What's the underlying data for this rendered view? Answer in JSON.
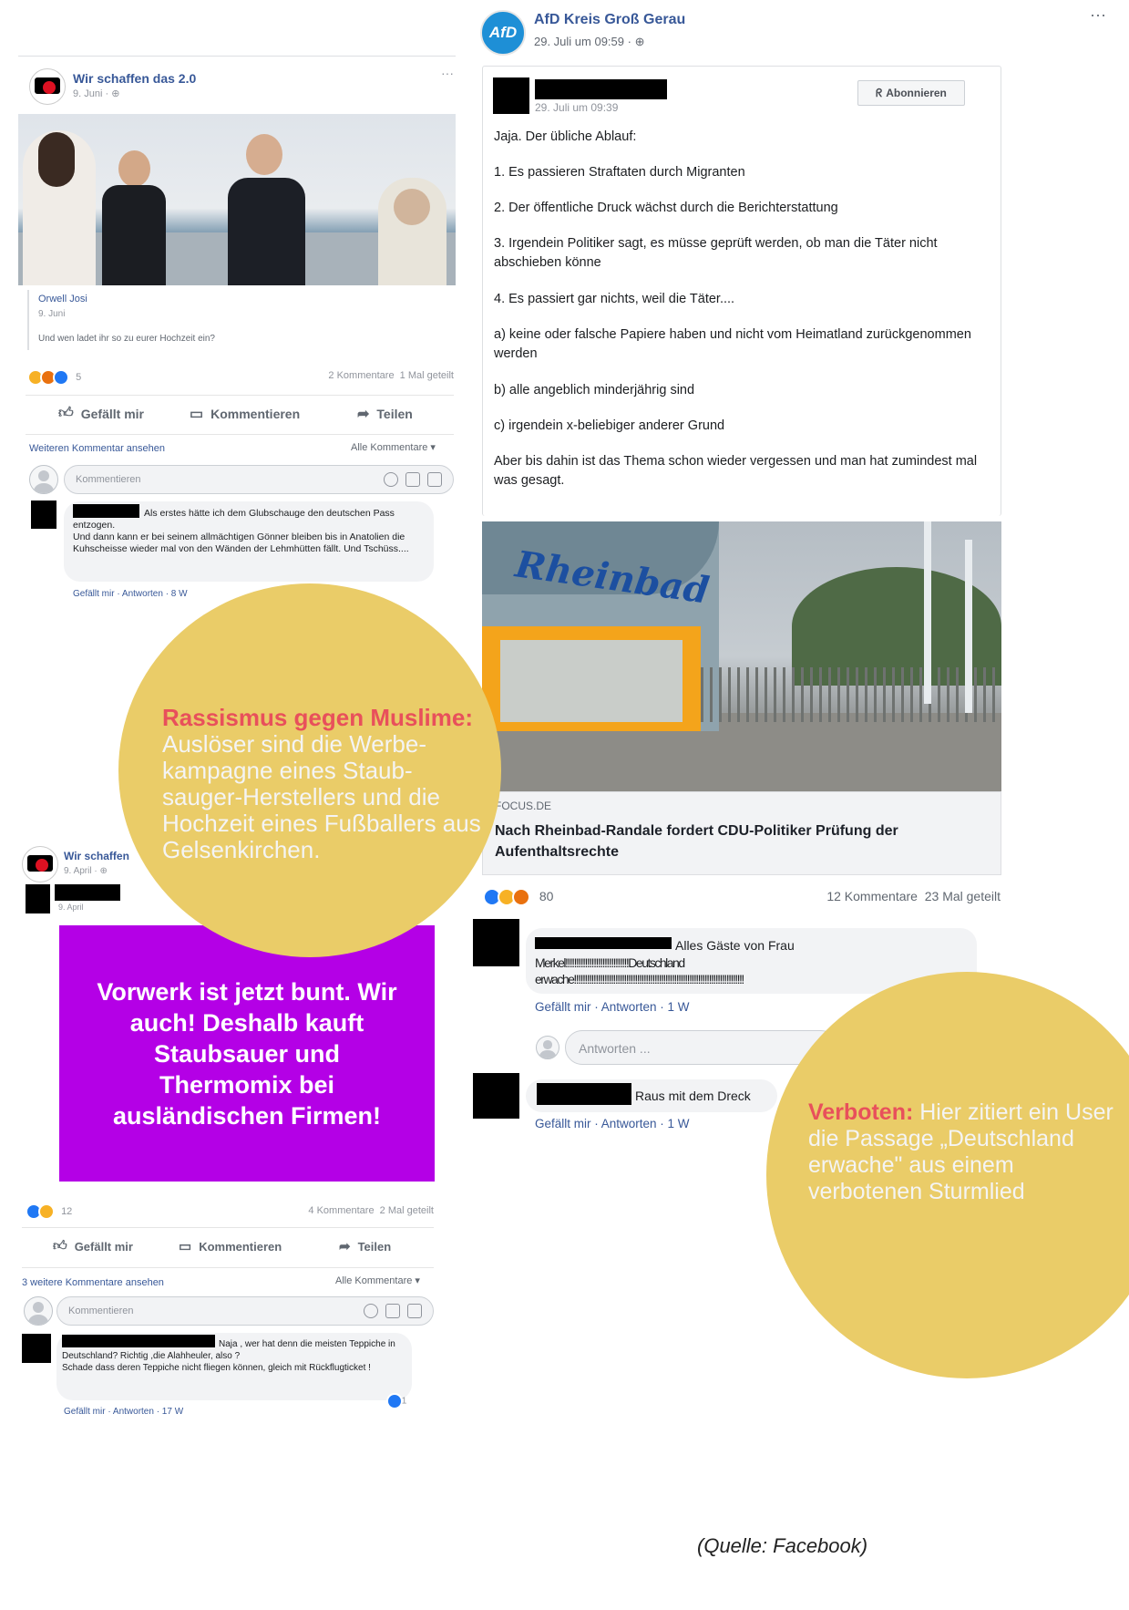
{
  "post_left": {
    "page_name": "Wir schaffen das 2.0",
    "date": "9. Juni",
    "options": "···",
    "quote": {
      "author": "Orwell Josi",
      "date": "9. Juni",
      "text": "Und wen ladet ihr so zu eurer Hochzeit ein?"
    },
    "reaction_count": "5",
    "stats": "2 Kommentare  1 Mal geteilt",
    "actions": {
      "like": "Gefällt mir",
      "comment": "Kommentieren",
      "share": "Teilen"
    },
    "more_comments": "Weiteren Kommentar ansehen",
    "filter": "Alle Kommentare ▾",
    "comment_placeholder": "Kommentieren",
    "comment": {
      "text": "Als erstes hätte ich dem Glubschauge den deutschen Pass entzogen.\nUnd dann kann er bei seinem allmächtigen Gönner bleiben bis in Anatolien die Kuhscheisse wieder mal von den Wänden der Lehmhütten fällt. Und Tschüss....",
      "actions": "Gefällt mir · Antworten · 8 W"
    }
  },
  "post_left2": {
    "page_name": "Wir schaffen",
    "date": "9. April",
    "author_date": "9. April",
    "image_text": "Vorwerk ist jetzt bunt. Wir auch! Deshalb kauft Staubsauer und Thermomix bei ausländischen Firmen!",
    "reaction_count": "12",
    "stats": "4 Kommentare  2 Mal geteilt",
    "actions": {
      "like": "Gefällt mir",
      "comment": "Kommentieren",
      "share": "Teilen"
    },
    "more_comments": "3 weitere Kommentare ansehen",
    "filter": "Alle Kommentare ▾",
    "comment_placeholder": "Kommentieren",
    "comment": {
      "text": "Naja , wer hat denn die meisten Teppiche in Deutschland? Richtig ,die Alahheuler, also ?\nSchade dass deren Teppiche nicht fliegen können, gleich mit Rückflugticket !",
      "actions": "Gefällt mir · Antworten · 17 W",
      "reaction": "1"
    }
  },
  "post_right": {
    "page_logo": "AfD",
    "page_name": "AfD Kreis Groß Gerau",
    "date": "29. Juli um 09:59 ·",
    "options": "···",
    "shared_date": "29. Juli um 09:39",
    "subscribe": "Abonnieren",
    "paragraphs": [
      "Jaja. Der übliche Ablauf:",
      "1. Es passieren Straftaten durch Migranten",
      "2. Der öffentliche Druck wächst durch die Berichterstattung",
      "3. Irgendein Politiker sagt, es müsse geprüft werden, ob man die Täter nicht abschieben könne",
      "4. Es passiert gar nichts, weil die Täter....",
      "a) keine oder falsche Papiere haben und nicht vom Heimatland zurückgenommen werden",
      "b) alle angeblich minderjährig sind",
      "c) irgendein x-beliebiger anderer Grund",
      "Aber bis dahin ist das Thema schon wieder vergessen und man hat zumindest mal was gesagt."
    ],
    "sign_text": "Rheinbad",
    "link_source": "FOCUS.DE",
    "link_title": "Nach Rheinbad-Randale fordert CDU-Politiker Prüfung der Aufenthaltsrechte",
    "reaction_count": "80",
    "stats": "12 Kommentare  23 Mal geteilt",
    "comment1": {
      "line1": "Alles Gäste von Frau",
      "line2": "Merkel!!!!!!!!!!!!!!!!!!!!!!!!!!!!!Deutschland",
      "line3": "erwache!!!!!!!!!!!!!!!!!!!!!!!!!!!!!!!!!!!!!!!!!!!!!!!!!!!!!!!!!!!!!!!!!!!!!!!!!!!!!!",
      "actions": "Gefällt mir · Antworten · 1 W"
    },
    "reply_placeholder": "Antworten ...",
    "comment2": {
      "text": "Raus mit dem Dreck",
      "actions": "Gefällt mir · Antworten · 1 W"
    }
  },
  "callout1": {
    "bold": "Rassismus gegen Muslime:",
    "text": "Auslöser sind die Werbe-kampagne eines Staub-sauger-Herstellers und die Hochzeit eines Fußballers aus Gelsenkirchen."
  },
  "callout2": {
    "bold": "Verboten:",
    "text": "Hier zitiert ein User die Passage „Deutschland erwache\" aus einem verbotenen Sturmlied"
  },
  "source": "(Quelle: Facebook)",
  "colors": {
    "callout": "#eacc68",
    "highlight": "#e8505b",
    "facebook_link": "#385898",
    "purple_card": "#b400e6"
  }
}
